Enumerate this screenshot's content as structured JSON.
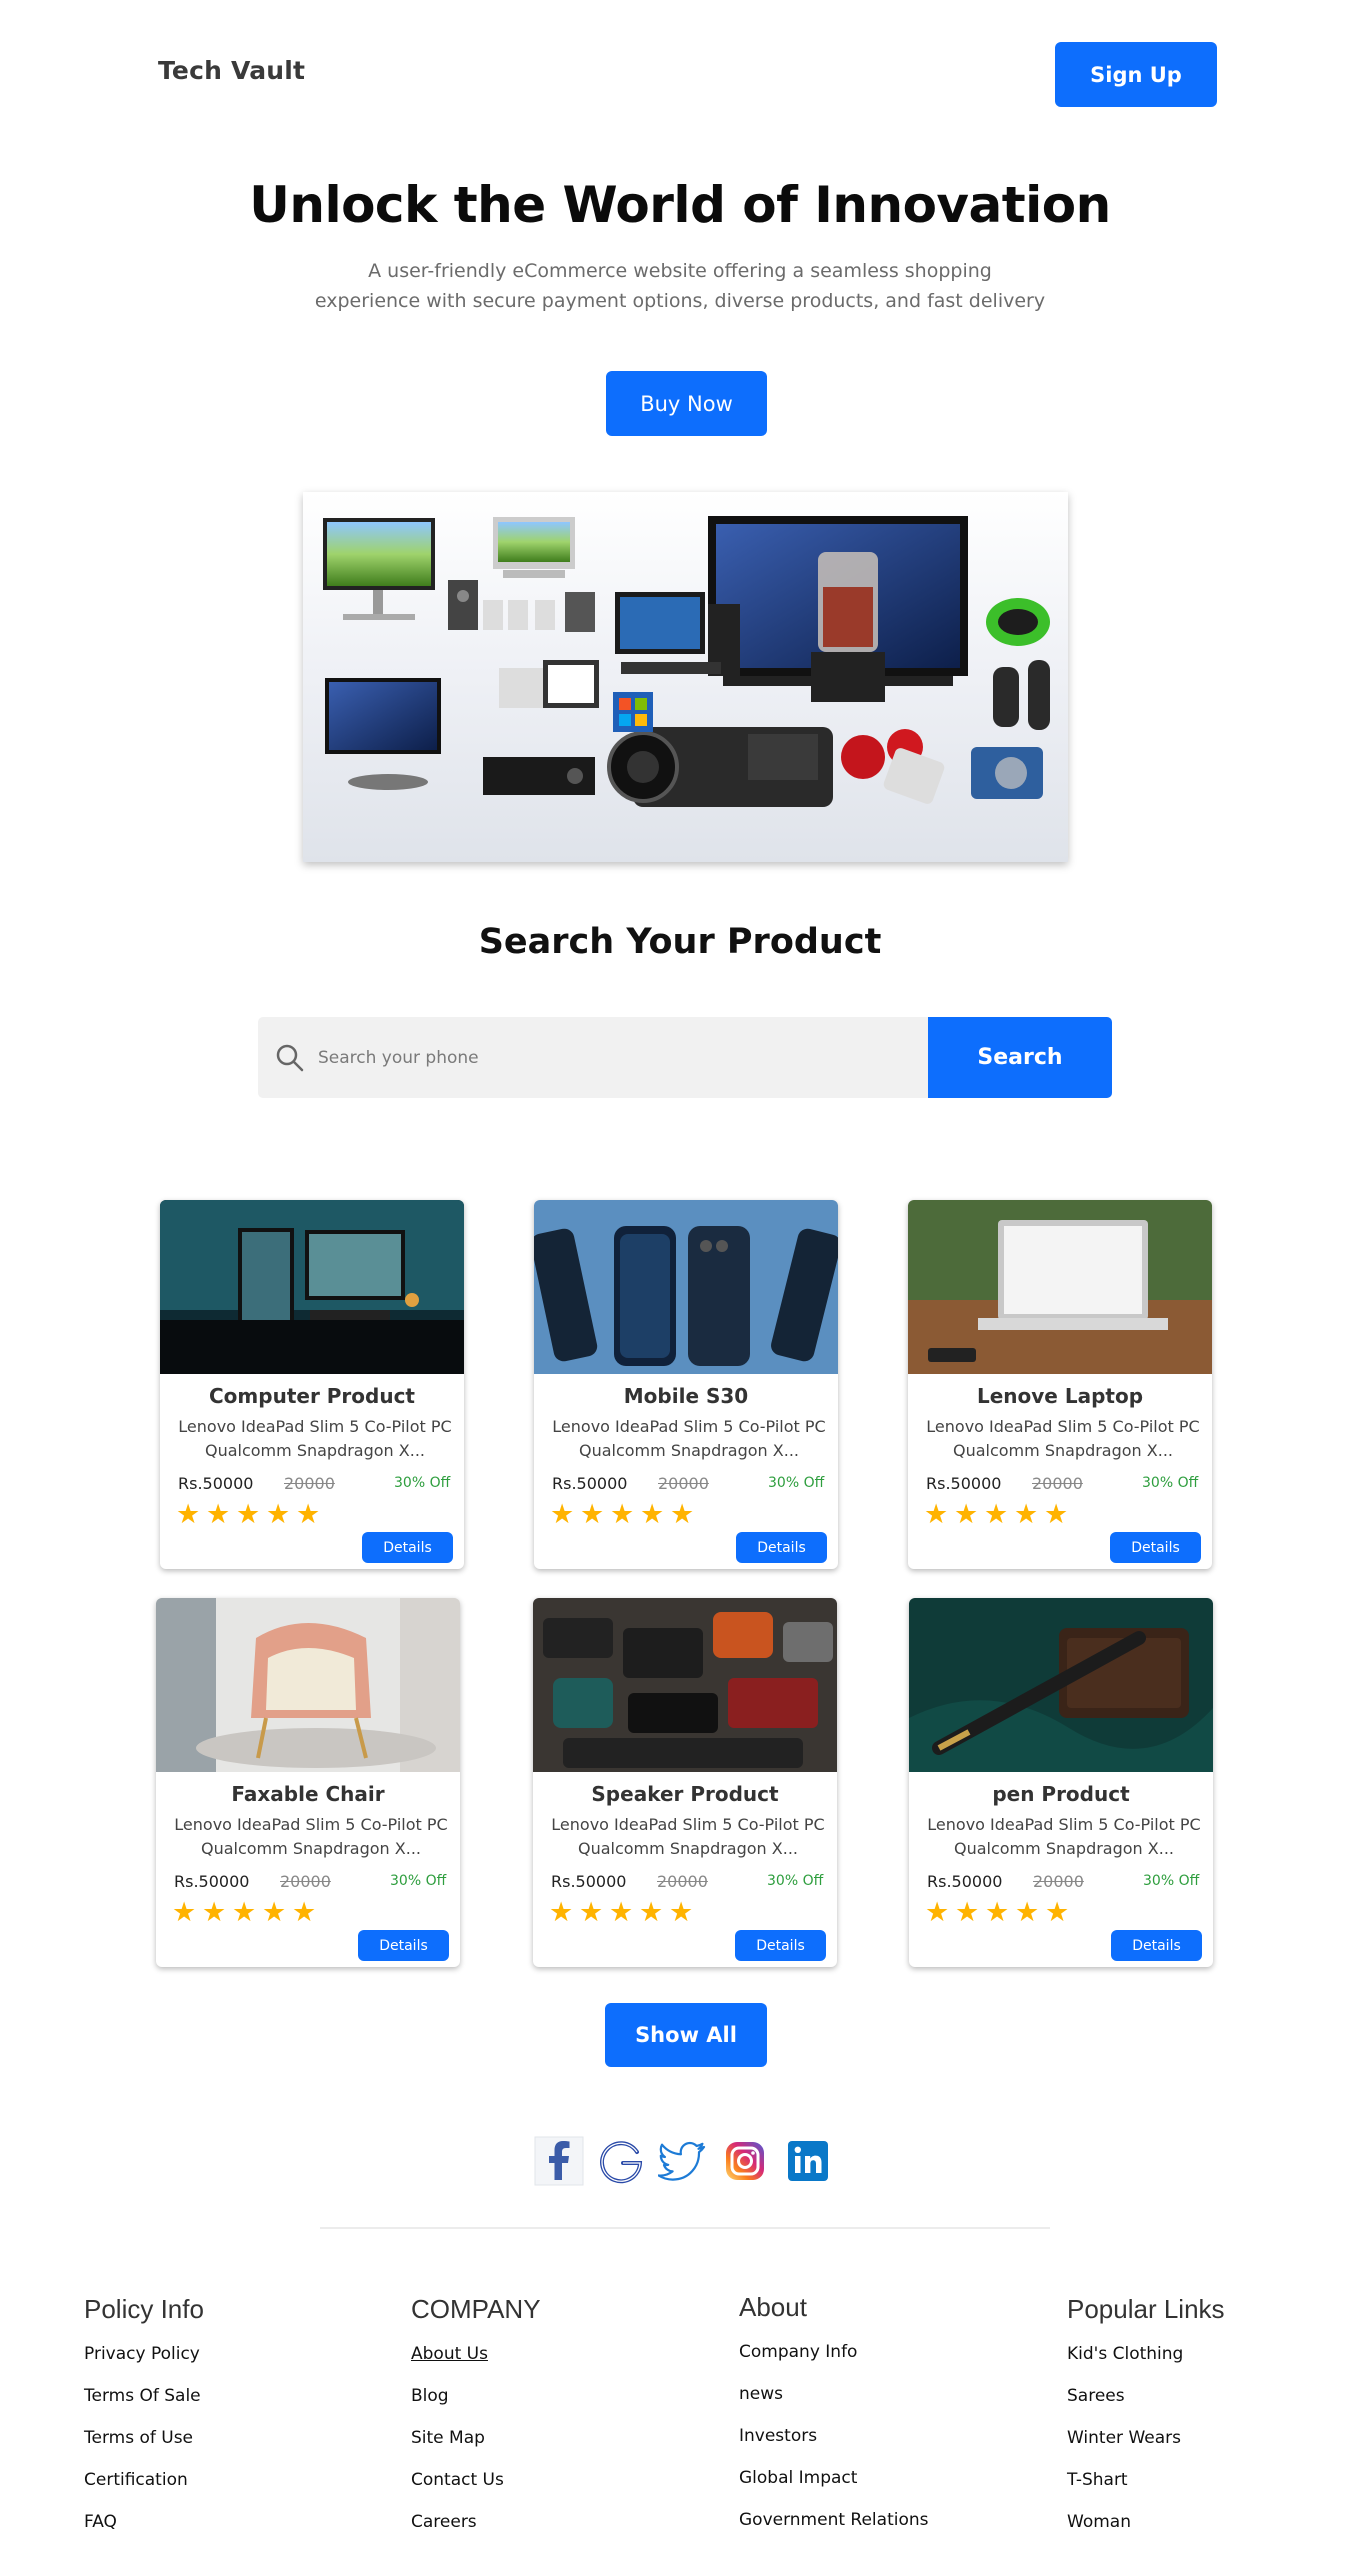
{
  "header": {
    "brand": "Tech Vault",
    "signup_label": "Sign Up"
  },
  "hero": {
    "title": "Unlock the World of Innovation",
    "subtitle_line1": "A user-friendly eCommerce website offering a seamless shopping",
    "subtitle_line2": "experience with secure payment options, diverse products, and fast delivery",
    "buy_label": "Buy Now"
  },
  "search": {
    "title": "Search Your Product",
    "placeholder": "Search your phone",
    "button_label": "Search"
  },
  "products": [
    {
      "title": "Computer Product",
      "desc": "Lenovo IdeaPad Slim 5 Co-Pilot PC Qualcomm Snapdragon X...",
      "price": "Rs.50000",
      "old_price": "20000",
      "discount": "30% Off",
      "rating": 5,
      "details_label": "Details"
    },
    {
      "title": "Mobile  S30",
      "desc": "Lenovo IdeaPad Slim 5 Co-Pilot PC Qualcomm Snapdragon X...",
      "price": "Rs.50000",
      "old_price": "20000",
      "discount": "30% Off",
      "rating": 5,
      "details_label": "Details"
    },
    {
      "title": "Lenove  Laptop",
      "desc": "Lenovo IdeaPad Slim 5 Co-Pilot PC Qualcomm Snapdragon X...",
      "price": "Rs.50000",
      "old_price": "20000",
      "discount": "30% Off",
      "rating": 5,
      "details_label": "Details"
    },
    {
      "title": "Faxable Chair",
      "desc": "Lenovo IdeaPad Slim 5 Co-Pilot PC Qualcomm Snapdragon X...",
      "price": "Rs.50000",
      "old_price": "20000",
      "discount": "30% Off",
      "rating": 5,
      "details_label": "Details"
    },
    {
      "title": "Speaker Product",
      "desc": "Lenovo IdeaPad Slim 5 Co-Pilot PC Qualcomm Snapdragon X...",
      "price": "Rs.50000",
      "old_price": "20000",
      "discount": "30% Off",
      "rating": 5,
      "details_label": "Details"
    },
    {
      "title": "pen  Product",
      "desc": "Lenovo IdeaPad Slim 5 Co-Pilot PC Qualcomm Snapdragon X...",
      "price": "Rs.50000",
      "old_price": "20000",
      "discount": "30% Off",
      "rating": 5,
      "details_label": "Details"
    }
  ],
  "show_all_label": "Show All",
  "social_icons": [
    "facebook-icon",
    "google-icon",
    "twitter-icon",
    "instagram-icon",
    "linkedin-icon"
  ],
  "footer": {
    "columns": [
      {
        "heading": "Policy Info",
        "links": [
          "Privacy Policy",
          "Terms Of Sale",
          "Terms of Use",
          "Certification",
          "FAQ"
        ]
      },
      {
        "heading": "COMPANY",
        "links": [
          "About Us",
          "Blog",
          "Site Map",
          "Contact Us",
          "Careers"
        ]
      },
      {
        "heading": "About",
        "links": [
          "Company Info",
          "news",
          "Investors",
          "Global Impact",
          "Government Relations"
        ]
      },
      {
        "heading": "Popular Links",
        "links": [
          "Kid's Clothing",
          "Sarees",
          "Winter Wears",
          "T-Shart",
          "Woman"
        ]
      }
    ]
  },
  "colors": {
    "accent": "#0d6efd",
    "discount": "#2e9e3e",
    "star": "#ffb300"
  }
}
